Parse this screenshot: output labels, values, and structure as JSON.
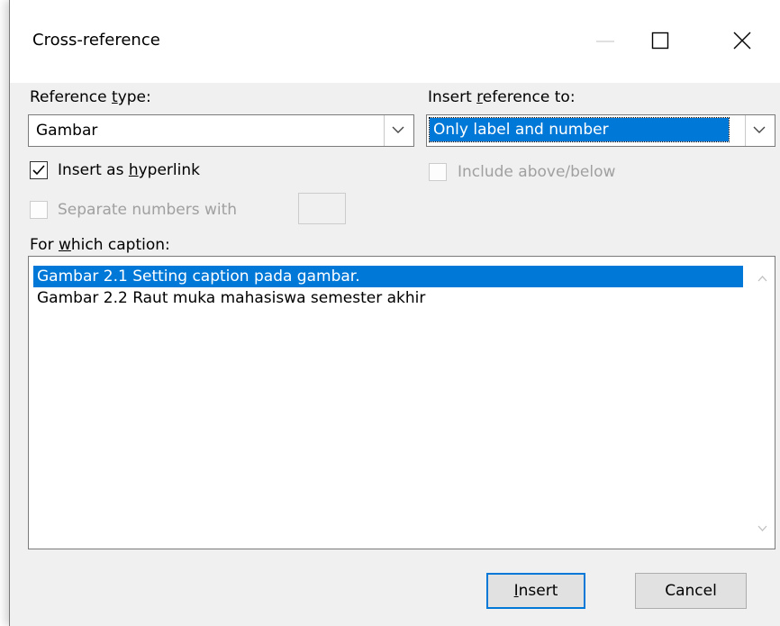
{
  "window": {
    "title": "Cross-reference",
    "controls": [
      "minimize-icon",
      "maximize-icon",
      "close-icon"
    ]
  },
  "reference_type": {
    "label_pre": "Reference ",
    "label_accel": "t",
    "label_post": "ype:",
    "value": "Gambar"
  },
  "insert_reference_to": {
    "label_pre": "Insert ",
    "label_accel": "r",
    "label_post": "eference to:",
    "value": "Only label and number"
  },
  "insert_as_hyperlink": {
    "label_pre": "Insert as ",
    "label_accel": "h",
    "label_post": "yperlink",
    "checked": true
  },
  "include_above_below": {
    "label": "Include above/below",
    "checked": false,
    "enabled": false
  },
  "separate_numbers": {
    "label": "Separate numbers with",
    "checked": false,
    "enabled": false,
    "value": ""
  },
  "caption_list": {
    "label_pre": "For ",
    "label_accel": "w",
    "label_post": "hich caption:",
    "items": [
      {
        "text": "Gambar 2.1 Setting caption pada gambar.",
        "selected": true
      },
      {
        "text": "Gambar 2.2 Raut muka mahasiswa semester akhir",
        "selected": false
      }
    ]
  },
  "buttons": {
    "insert_accel": "I",
    "insert_rest": "nsert",
    "cancel": "Cancel"
  },
  "colors": {
    "accent": "#0078d7",
    "dialog_bg": "#f0f0f0",
    "disabled_text": "#a0a0a0"
  }
}
